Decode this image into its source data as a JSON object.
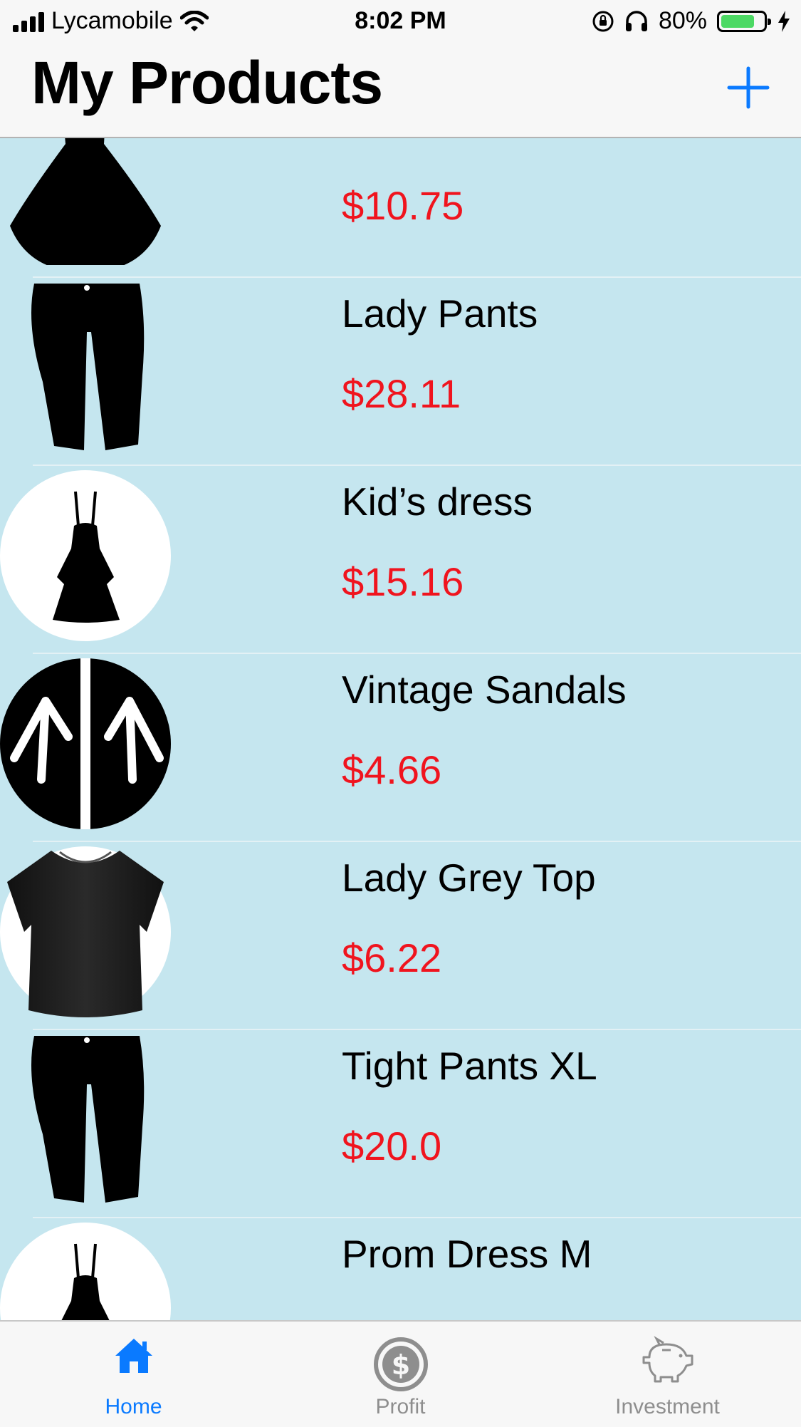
{
  "status_bar": {
    "carrier": "Lycamobile",
    "time": "8:02 PM",
    "battery_percent": "80%",
    "battery_level": 0.8
  },
  "navbar": {
    "title": "My Products",
    "add_icon": "plus-icon"
  },
  "products": [
    {
      "name": "",
      "price": "$10.75",
      "icon": "dress-icon"
    },
    {
      "name": "Lady Pants",
      "price": "$28.11",
      "icon": "pants-icon"
    },
    {
      "name": "Kid’s dress",
      "price": "$15.16",
      "icon": "kids-dress-icon"
    },
    {
      "name": "Vintage Sandals",
      "price": "$4.66",
      "icon": "sandals-icon"
    },
    {
      "name": "Lady Grey Top",
      "price": "$6.22",
      "icon": "tshirt-icon"
    },
    {
      "name": "Tight Pants XL",
      "price": "$20.0",
      "icon": "pants-icon"
    },
    {
      "name": "Prom Dress M",
      "price": "",
      "icon": "kids-dress-icon"
    }
  ],
  "tabs": [
    {
      "label": "Home",
      "icon": "home-icon",
      "selected": true
    },
    {
      "label": "Profit",
      "icon": "dollar-coin-icon",
      "selected": false
    },
    {
      "label": "Investment",
      "icon": "piggy-bank-icon",
      "selected": false
    }
  ],
  "colors": {
    "accent": "#0a7aff",
    "price": "#f0141e",
    "list_background": "#c5e6ef",
    "bar_background": "#f7f7f7",
    "inactive_tab": "#8e8e8e"
  }
}
